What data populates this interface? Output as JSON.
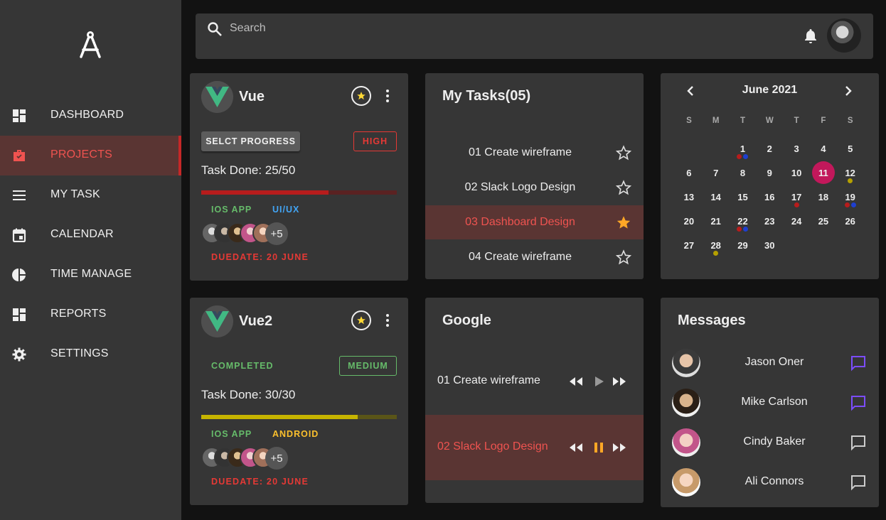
{
  "sidebar": {
    "items": [
      {
        "label": "DASHBOARD",
        "icon": "dashboard-icon"
      },
      {
        "label": "PROJECTS",
        "icon": "briefcase-icon",
        "active": true
      },
      {
        "label": "MY TASK",
        "icon": "menu-lines-icon"
      },
      {
        "label": "CALENDAR",
        "icon": "calendar-icon"
      },
      {
        "label": "TIME MANAGE",
        "icon": "pie-chart-icon"
      },
      {
        "label": "REPORTS",
        "icon": "dashboard-icon"
      },
      {
        "label": "SETTINGS",
        "icon": "gear-icon"
      }
    ]
  },
  "topbar": {
    "search_placeholder": "Search"
  },
  "projects": [
    {
      "title": "Vue",
      "button": "SELCT PROGRESS",
      "priority": "HIGH",
      "task_done": "Task Done: 25/50",
      "progress": 0.65,
      "tags": [
        "IOS APP",
        "UI/UX"
      ],
      "more": "+5",
      "due": "DUEDATE: 20 JUNE"
    },
    {
      "title": "Vue2",
      "status": "COMPLETED",
      "priority": "MEDIUM",
      "task_done": "Task Done: 30/30",
      "progress": 0.8,
      "tags": [
        "IOS APP",
        "ANDROID"
      ],
      "more": "+5",
      "due": "DUEDATE: 20 JUNE"
    }
  ],
  "my_tasks": {
    "title": "My Tasks(05)",
    "items": [
      {
        "label": "01 Create wireframe",
        "starred": false
      },
      {
        "label": "02 Slack Logo Design",
        "starred": false
      },
      {
        "label": "03 Dashboard Design",
        "starred": true
      },
      {
        "label": "04 Create wireframe",
        "starred": false
      }
    ]
  },
  "calendar": {
    "month": "June 2021",
    "weekdays": [
      "S",
      "M",
      "T",
      "W",
      "T",
      "F",
      "S"
    ],
    "days": [
      "",
      "",
      "1",
      "2",
      "3",
      "4",
      "5",
      "6",
      "7",
      "8",
      "9",
      "10",
      "11",
      "12",
      "13",
      "14",
      "15",
      "16",
      "17",
      "18",
      "19",
      "20",
      "21",
      "22",
      "23",
      "24",
      "25",
      "26",
      "27",
      "28",
      "29",
      "30"
    ],
    "today": "11"
  },
  "google": {
    "title": "Google",
    "items": [
      {
        "label": "01 Create wireframe",
        "playing": false
      },
      {
        "label": "02 Slack Logo Design",
        "playing": true
      }
    ]
  },
  "messages": {
    "title": "Messages",
    "items": [
      {
        "name": "Jason Oner",
        "unread": true
      },
      {
        "name": "Mike Carlson",
        "unread": true
      },
      {
        "name": "Cindy Baker",
        "unread": false
      },
      {
        "name": "Ali Connors",
        "unread": false
      }
    ]
  },
  "colors": {
    "accent": "#e53935",
    "unread": "#7c4dff",
    "star": "#fbc02d",
    "today": "#c2185b"
  }
}
